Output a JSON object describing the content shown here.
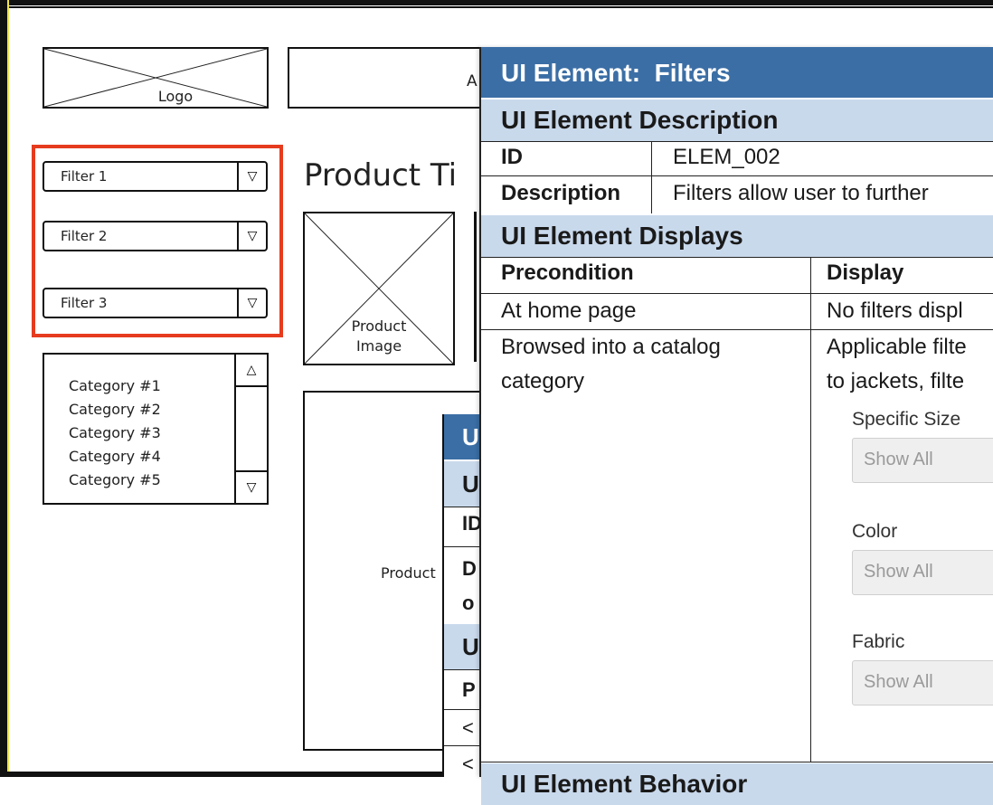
{
  "wireframe": {
    "logo_label": "Logo",
    "header_text_fragment": "A",
    "filters": [
      {
        "label": "Filter 1",
        "icon": "▽"
      },
      {
        "label": "Filter 2",
        "icon": "▽"
      },
      {
        "label": "Filter 3",
        "icon": "▽"
      }
    ],
    "categories": [
      "Category #1",
      "Category #2",
      "Category #3",
      "Category #4",
      "Category #5"
    ],
    "scroll_up": "△",
    "scroll_down": "▽",
    "product_title": "Product Ti",
    "product_image_label_1": "Product",
    "product_image_label_2": "Image",
    "product_desc_label": "Product",
    "highlight_color": "#e63b1f",
    "bg_table_letters": [
      "U",
      "U",
      "ID",
      "D",
      "o",
      "U",
      "P",
      "<",
      "<"
    ]
  },
  "spec": {
    "title": "UI Element:  Filters",
    "description_header": "UI Element Description",
    "id_label": "ID",
    "id_value": "ELEM_002",
    "description_label": "Description",
    "description_value": "Filters allow user to further",
    "displays_header": "UI Element Displays",
    "col_precondition": "Precondition",
    "col_display": "Display",
    "rows": [
      {
        "precondition": "At home page",
        "display": "No filters displ"
      },
      {
        "precondition_1": "Browsed into a catalog",
        "precondition_2": "category",
        "display_1": "Applicable filte",
        "display_2": "to jackets, filte"
      }
    ],
    "filter_fields": [
      {
        "label": "Specific Size",
        "value": "Show All"
      },
      {
        "label": "Color",
        "value": "Show All"
      },
      {
        "label": "Fabric",
        "value": "Show All"
      }
    ],
    "bottom_header_fragment": "UI Element Behavior",
    "header_color": "#3b6ea5",
    "subheader_color": "#c9d9ec"
  }
}
